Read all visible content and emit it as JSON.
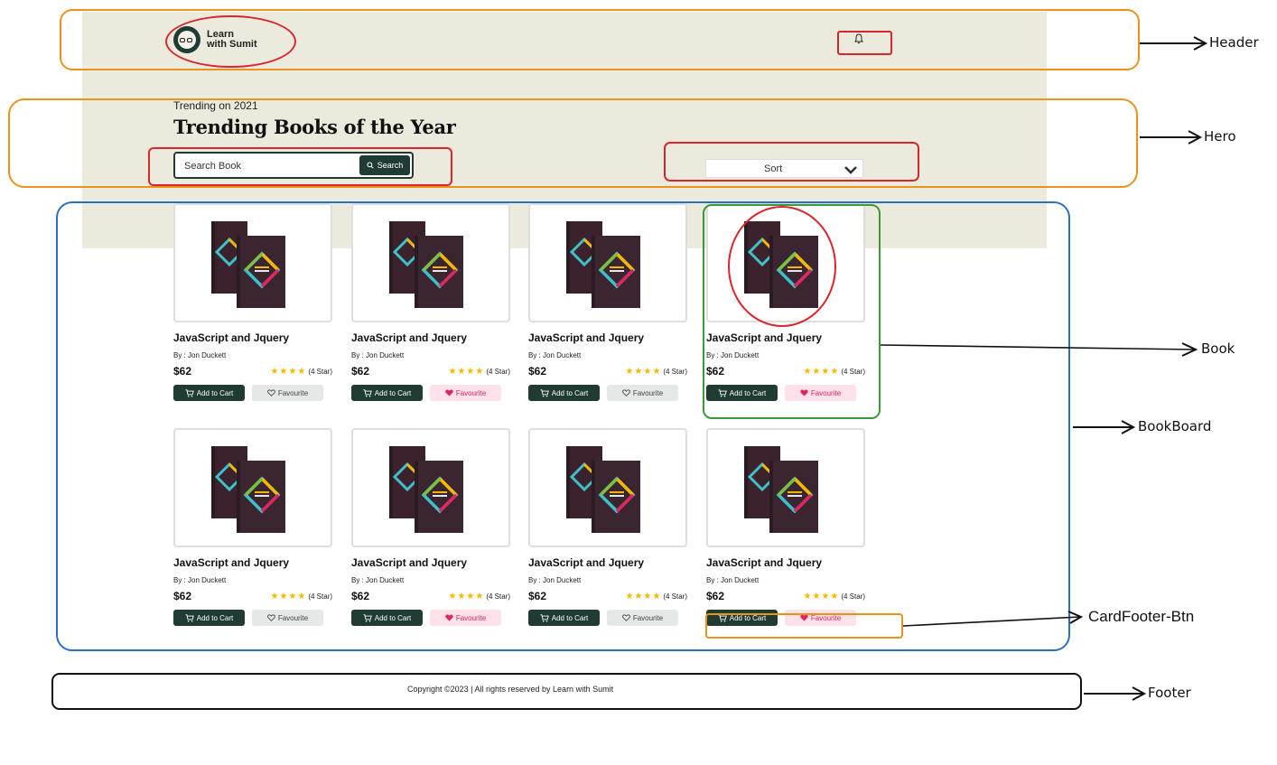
{
  "header": {
    "logo_line1": "Learn",
    "logo_line2": "with Sumit"
  },
  "hero": {
    "subtitle": "Trending on 2021",
    "title": "Trending Books of the Year",
    "search_placeholder": "Search Book",
    "search_button": "Search",
    "sort_label": "Sort"
  },
  "books": [
    {
      "title": "JavaScript and Jquery",
      "author": "By : Jon Duckett",
      "price": "$62",
      "rating": 4,
      "rating_text": "(4 Star)",
      "cart_label": "Add to Cart",
      "fav_label": "Favourite",
      "favourite": false
    },
    {
      "title": "JavaScript and Jquery",
      "author": "By : Jon Duckett",
      "price": "$62",
      "rating": 4,
      "rating_text": "(4 Star)",
      "cart_label": "Add to Cart",
      "fav_label": "Favourite",
      "favourite": true
    },
    {
      "title": "JavaScript and Jquery",
      "author": "By : Jon Duckett",
      "price": "$62",
      "rating": 4,
      "rating_text": "(4 Star)",
      "cart_label": "Add to Cart",
      "fav_label": "Favourite",
      "favourite": false
    },
    {
      "title": "JavaScript and Jquery",
      "author": "By : Jon Duckett",
      "price": "$62",
      "rating": 4,
      "rating_text": "(4 Star)",
      "cart_label": "Add to Cart",
      "fav_label": "Favourite",
      "favourite": true
    },
    {
      "title": "JavaScript and Jquery",
      "author": "By : Jon Duckett",
      "price": "$62",
      "rating": 4,
      "rating_text": "(4 Star)",
      "cart_label": "Add to Cart",
      "fav_label": "Favourite",
      "favourite": false
    },
    {
      "title": "JavaScript and Jquery",
      "author": "By : Jon Duckett",
      "price": "$62",
      "rating": 4,
      "rating_text": "(4 Star)",
      "cart_label": "Add to Cart",
      "fav_label": "Favourite",
      "favourite": true
    },
    {
      "title": "JavaScript and Jquery",
      "author": "By : Jon Duckett",
      "price": "$62",
      "rating": 4,
      "rating_text": "(4 Star)",
      "cart_label": "Add to Cart",
      "fav_label": "Favourite",
      "favourite": false
    },
    {
      "title": "JavaScript and Jquery",
      "author": "By : Jon Duckett",
      "price": "$62",
      "rating": 4,
      "rating_text": "(4 Star)",
      "cart_label": "Add to Cart",
      "fav_label": "Favourite",
      "favourite": true
    }
  ],
  "footer": {
    "copyright": "Copyright ©2023 | All rights reserved by Learn with Sumit"
  },
  "annotations": {
    "header": "Header",
    "hero": "Hero",
    "book": "Book",
    "bookboard": "BookBoard",
    "cardfooter": "CardFooter-Btn",
    "footer": "Footer"
  },
  "colors": {
    "brand": "#1f3b34",
    "hero_bg": "#ece9dd",
    "star": "#f5b800",
    "favourite_active": "#e0245e",
    "annotation_orange": "#e8941a",
    "annotation_red": "#d9262c",
    "annotation_blue": "#2a6fc4",
    "annotation_green": "#3a9a3a"
  }
}
